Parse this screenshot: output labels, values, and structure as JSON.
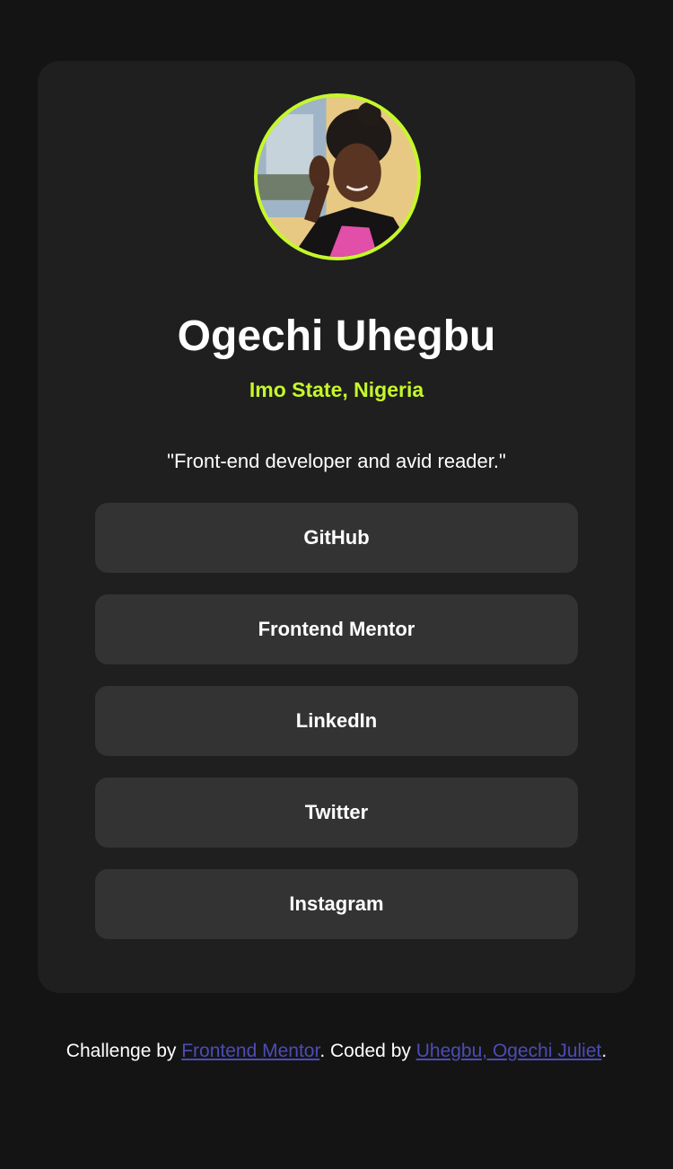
{
  "profile": {
    "name": "Ogechi Uhegbu",
    "location": "Imo State, Nigeria",
    "bio": "\"Front-end developer and avid reader.\"",
    "avatar_icon": "profile-photo"
  },
  "links": [
    {
      "label": "GitHub"
    },
    {
      "label": "Frontend Mentor"
    },
    {
      "label": "LinkedIn"
    },
    {
      "label": "Twitter"
    },
    {
      "label": "Instagram"
    }
  ],
  "footer": {
    "prefix": "Challenge by ",
    "challenge_link": "Frontend Mentor",
    "middle": ". Coded by ",
    "author_link": "Uhegbu, Ogechi Juliet",
    "suffix": "."
  },
  "colors": {
    "page_background": "#141414",
    "card_background": "#1f1f1f",
    "button_background": "#333333",
    "accent": "#c5f82a",
    "footer_link": "#4c4cb6",
    "text": "#ffffff"
  }
}
